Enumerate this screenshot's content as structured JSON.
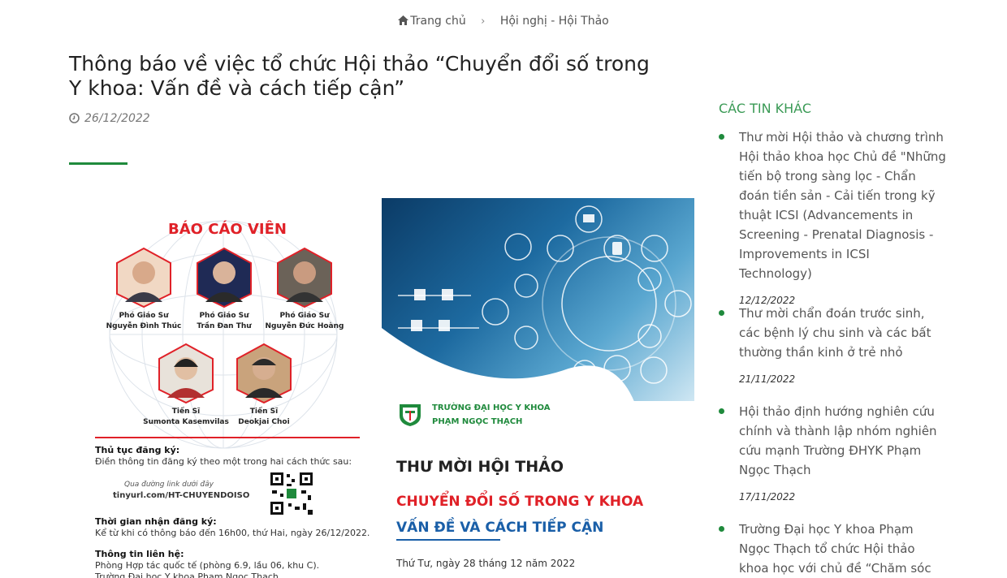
{
  "breadcrumb": {
    "home": "Trang chủ",
    "category": "Hội nghị - Hội Thảo"
  },
  "article": {
    "title": "Thông báo về việc tổ chức Hội thảo “Chuyển đổi số trong Y khoa: Vấn đề và cách tiếp cận”",
    "date": "26/12/2022"
  },
  "poster": {
    "speakers_heading": "BÁO CÁO VIÊN",
    "speakers": [
      {
        "role": "Phó Giáo Sư",
        "name": "Nguyễn Đình Thúc"
      },
      {
        "role": "Phó Giáo Sư",
        "name": "Trần Đan Thư"
      },
      {
        "role": "Phó Giáo Sư",
        "name": "Nguyễn Đức Hoàng"
      },
      {
        "role": "Tiến Sĩ",
        "name": "Sumonta Kasemvilas"
      },
      {
        "role": "Tiến Sĩ",
        "name": "Deokjai Choi"
      }
    ],
    "reg_heading": "Thủ tục đăng ký:",
    "reg_text": "Điền thông tin đăng ký theo một trong hai cách thức sau:",
    "reg_link_hint": "Qua đường link dưới đây",
    "reg_link": "tinyurl.com/HT-CHUYENDOISO",
    "time_heading": "Thời gian nhận đăng ký:",
    "time_text": "Kể từ khi có thông báo đến 16h00, thứ Hai, ngày 26/12/2022.",
    "contact_heading": "Thông tin liên hệ:",
    "contact_text1": "Phòng Hợp tác quốc tế (phòng 6.9, lầu 06, khu C).",
    "contact_text2": "Trường Đại học Y khoa Phạm Ngọc Thạch",
    "school_line1": "TRƯỜNG ĐẠI HỌC Y KHOA",
    "school_line2": "PHẠM NGỌC THẠCH",
    "invite": "THƯ MỜI HỘI THẢO",
    "topic_line1": "CHUYỂN ĐỔI SỐ TRONG Y KHOA",
    "topic_line2": "VẤN ĐỀ VÀ CÁCH TIẾP CẬN",
    "event_date": "Thứ Tư, ngày 28 tháng 12 năm 2022"
  },
  "sidebar": {
    "title": "CÁC TIN KHÁC",
    "items": [
      {
        "text": "Thư mời Hội thảo và chương trình Hội thảo khoa học Chủ đề \"Những tiến bộ trong sàng lọc - Chẩn đoán tiền sản - Cải tiến trong kỹ thuật ICSI (Advancements in Screening - Prenatal Diagnosis - Improvements in ICSI Technology)",
        "date": "12/12/2022"
      },
      {
        "text": "Thư mời chẩn đoán trước sinh, các bệnh lý chu sinh và các bất thường thần kinh ở trẻ nhỏ",
        "date": "21/11/2022"
      },
      {
        "text": "Hội thảo định hướng nghiên cứu chính và thành lập nhóm nghiên cứu mạnh Trường ĐHYK Phạm Ngọc Thạch",
        "date": "17/11/2022"
      },
      {
        "text": "Trường Đại học Y khoa Phạm Ngọc Thạch tổ chức Hội thảo khoa học với chủ đề “Chăm sóc dinh dưỡng",
        "date": ""
      }
    ]
  },
  "colors": {
    "accent_green": "#1f8a3c",
    "poster_red": "#e02128",
    "poster_blue": "#1a5fa8"
  }
}
